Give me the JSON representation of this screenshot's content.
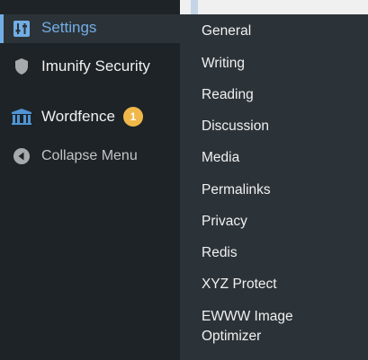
{
  "sidebar": {
    "items": [
      {
        "label": "Settings",
        "icon": "settings-sliders-icon",
        "current": true
      },
      {
        "label": "Imunify Security",
        "icon": "shield-icon"
      },
      {
        "label": "Wordfence",
        "icon": "wordfence-logo-icon",
        "badge": "1"
      },
      {
        "label": "Collapse Menu",
        "icon": "collapse-arrow-icon"
      }
    ]
  },
  "submenu": {
    "items": [
      {
        "label": "General"
      },
      {
        "label": "Writing"
      },
      {
        "label": "Reading"
      },
      {
        "label": "Discussion"
      },
      {
        "label": "Media"
      },
      {
        "label": "Permalinks"
      },
      {
        "label": "Privacy"
      },
      {
        "label": "Redis"
      },
      {
        "label": "XYZ Protect"
      },
      {
        "label": "EWWW Image Optimizer"
      }
    ]
  },
  "colors": {
    "sidebar_bg": "#1d2327",
    "submenu_bg": "#2c3338",
    "accent": "#72aee6",
    "badge": "#f0b849"
  }
}
